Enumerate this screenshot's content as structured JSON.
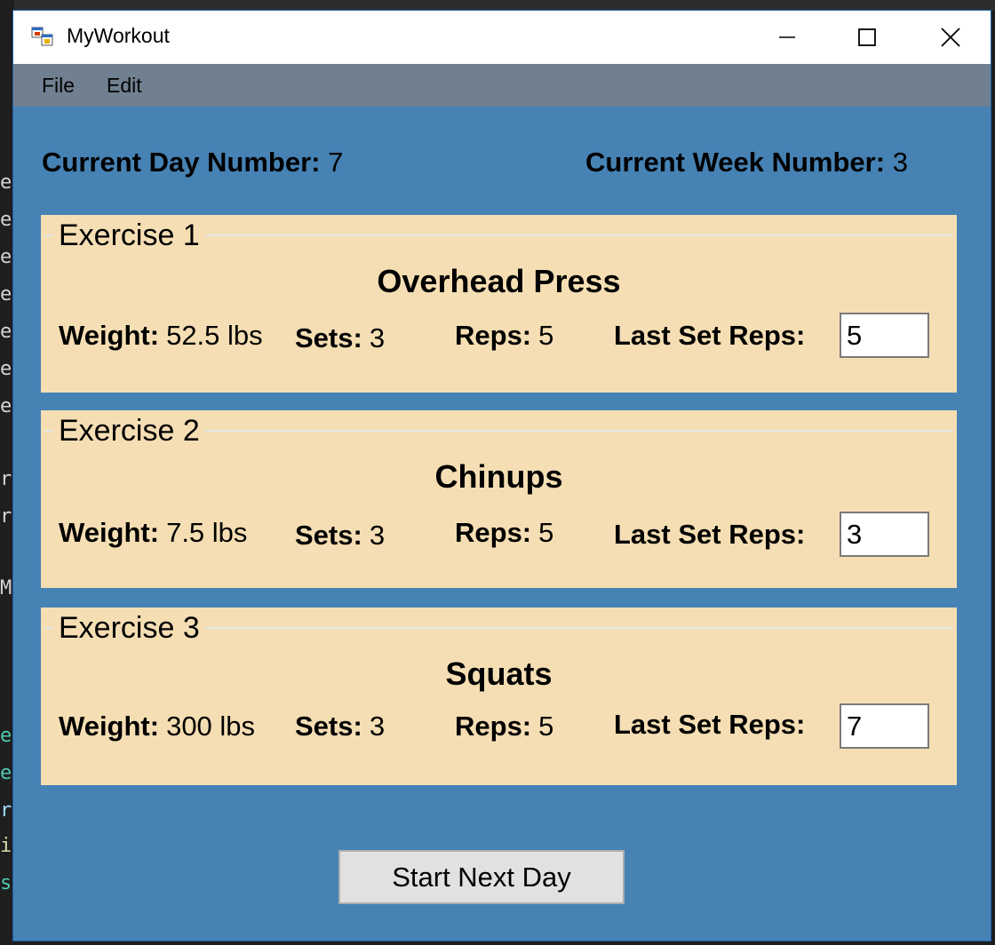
{
  "window": {
    "title": "MyWorkout"
  },
  "menu": {
    "items": [
      "File",
      "Edit"
    ]
  },
  "status": {
    "day_label": "Current Day Number:",
    "day_value": "7",
    "week_label": "Current Week Number:",
    "week_value": "3"
  },
  "labels": {
    "weight": "Weight:",
    "sets": "Sets:",
    "reps": "Reps:",
    "last_set_reps": "Last Set Reps:"
  },
  "exercises": [
    {
      "caption": "Exercise 1",
      "name": "Overhead Press",
      "weight": "52.5 lbs",
      "sets": "3",
      "reps": "5",
      "last_set_reps": "5"
    },
    {
      "caption": "Exercise 2",
      "name": "Chinups",
      "weight": "7.5 lbs",
      "sets": "3",
      "reps": "5",
      "last_set_reps": "3"
    },
    {
      "caption": "Exercise 3",
      "name": "Squats",
      "weight": "300 lbs",
      "sets": "3",
      "reps": "5",
      "last_set_reps": "7"
    }
  ],
  "actions": {
    "start_next_day": "Start Next Day"
  },
  "colors": {
    "form_background": "#4682b4",
    "menubar": "#708090",
    "group_background": "#f5deb3",
    "button_face": "#e1e1e1"
  },
  "icons": {
    "app": "app-window-icon",
    "minimize": "minimize-icon",
    "maximize": "maximize-icon",
    "close": "close-icon"
  }
}
